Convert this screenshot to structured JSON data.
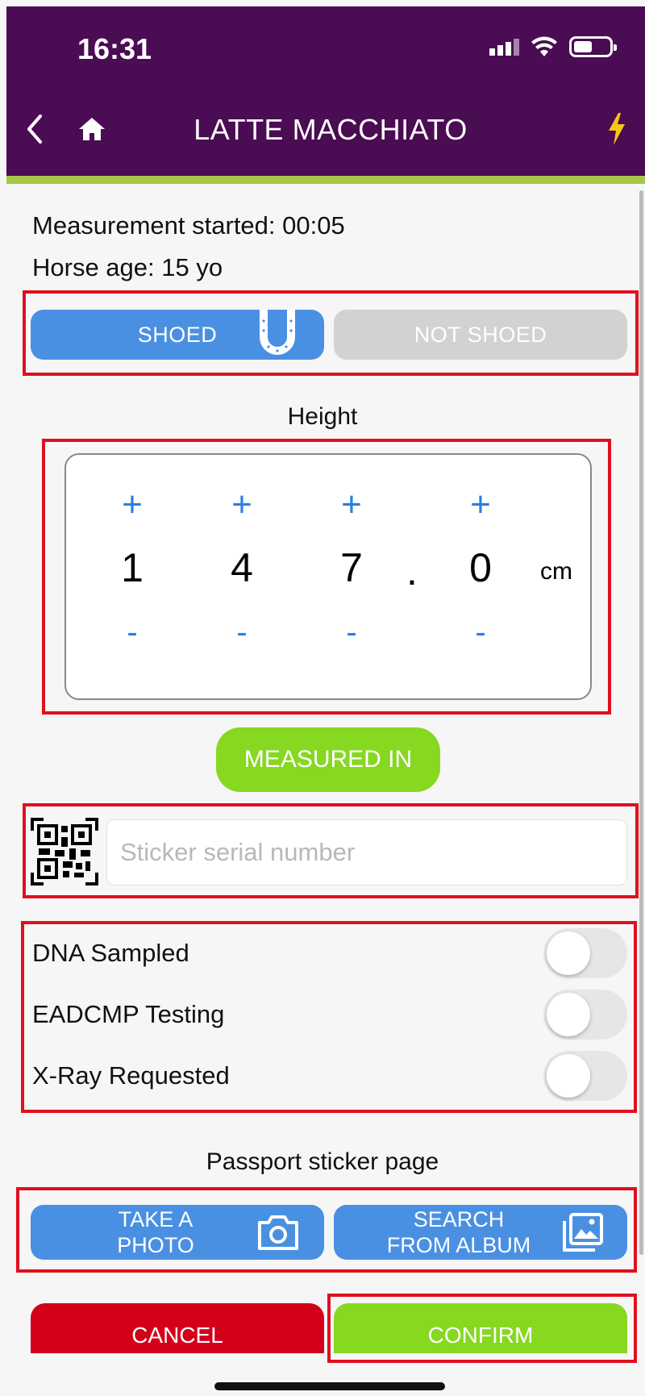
{
  "status_bar": {
    "time": "16:31"
  },
  "header": {
    "title": "LATTE MACCHIATO"
  },
  "info": {
    "measurement_started": "Measurement started: 00:05",
    "horse_age": "Horse age: 15 yo"
  },
  "shoe_toggle": {
    "shoed_label": "SHOED",
    "not_shoed_label": "NOT SHOED",
    "selected": "SHOED"
  },
  "height": {
    "title": "Height",
    "digits": [
      "1",
      "4",
      "7",
      "0"
    ],
    "decimal_point": ".",
    "plus_symbol": "+",
    "minus_symbol": "-",
    "unit": "cm"
  },
  "measured_in_label": "MEASURED IN",
  "sticker": {
    "placeholder": "Sticker serial number",
    "value": ""
  },
  "toggles": [
    {
      "label": "DNA Sampled",
      "on": false
    },
    {
      "label": "EADCMP Testing",
      "on": false
    },
    {
      "label": "X-Ray Requested",
      "on": false
    }
  ],
  "passport": {
    "title": "Passport sticker page",
    "take_photo_line1": "TAKE A",
    "take_photo_line2": "PHOTO",
    "search_album_line1": "SEARCH",
    "search_album_line2": "FROM ALBUM"
  },
  "actions": {
    "cancel_label": "CANCEL",
    "confirm_label": "CONFIRM"
  },
  "colors": {
    "header_bg": "#4a0c52",
    "accent_bar": "#a6c64a",
    "primary_blue": "#4a90e2",
    "green": "#86d820",
    "red": "#d4001a",
    "highlight_box": "#e0101e"
  }
}
